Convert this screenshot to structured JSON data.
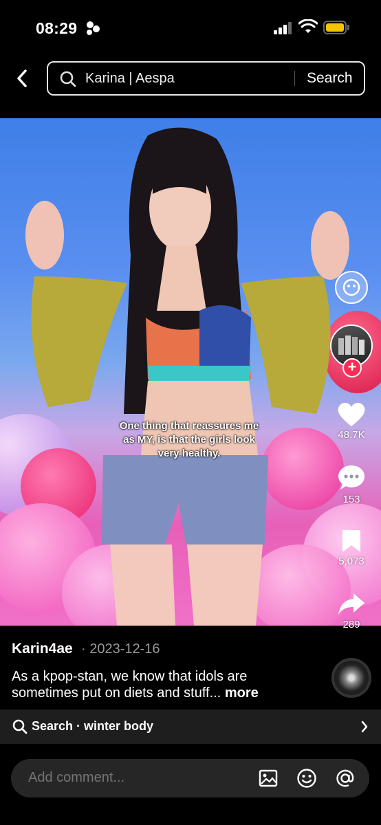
{
  "status_bar": {
    "time": "08:29"
  },
  "header": {
    "search_query": "Karina | Aespa",
    "search_button": "Search"
  },
  "video": {
    "caption_line1": "One thing that reassures me",
    "caption_line2": "as MY, is that the girls look",
    "caption_line3": "very healthy."
  },
  "actions": {
    "likes": "48.7K",
    "comments": "153",
    "saves": "5,073",
    "shares": "289"
  },
  "post": {
    "username": "Karin4ae",
    "date_prefix": "· ",
    "date": "2023-12-16",
    "description": "As a kpop-stan, we know that idols are sometimes put on diets and stuff...",
    "more": "more"
  },
  "related_search": {
    "label": "Search · winter body"
  },
  "comment_bar": {
    "placeholder": "Add comment..."
  },
  "colors": {
    "accent": "#fe2c55",
    "battery": "#f5c400"
  }
}
